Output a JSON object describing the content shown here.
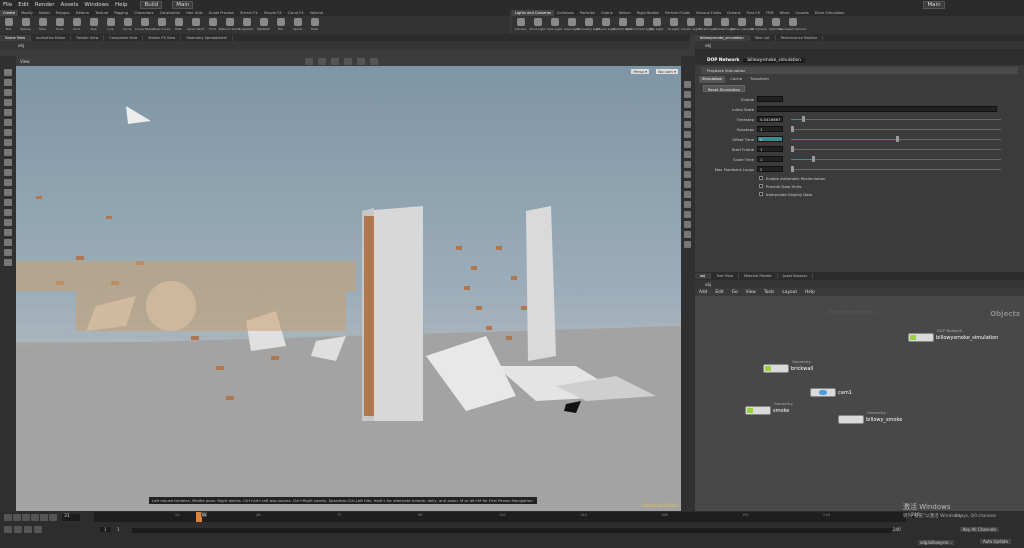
{
  "menu": {
    "items": [
      "File",
      "Edit",
      "Render",
      "Assets",
      "Windows",
      "Help"
    ],
    "desktop": "Build",
    "main": "Main",
    "right_label": "Main"
  },
  "shelf_left": {
    "tabs": [
      "Create",
      "Modify",
      "Model",
      "Polygon",
      "Deform",
      "Texture",
      "Rigging",
      "Characters",
      "Constraints",
      "Hair Utils",
      "Guide Process",
      "Terrain FX",
      "Simple FX",
      "Cloud FX",
      "Volume"
    ],
    "tools": [
      "Box",
      "Sphere",
      "Tube",
      "Torus",
      "Grid",
      "Null",
      "Line",
      "Circle",
      "Curve Bezier",
      "Draw Curve",
      "Path",
      "Spray Paint",
      "Font",
      "Platonic Solids",
      "L-System",
      "Metaball",
      "File",
      "Spiral",
      "Helix"
    ]
  },
  "shelf_right": {
    "tabs": [
      "Lights and Cameras",
      "Collisions",
      "Particles",
      "Grains",
      "Vellum",
      "Rigid Bodies",
      "Particle Fluids",
      "Viscous Fluids",
      "Oceans",
      "Pyro FX",
      "FEM",
      "Wires",
      "Crowds",
      "Drive Simulation"
    ],
    "tools": [
      "Camera",
      "Point Light",
      "Spot Light",
      "Area Light",
      "Geometry Light",
      "Volume Light",
      "Distant Light",
      "Environment Light",
      "Sky Light",
      "GI Light",
      "Caustic Light",
      "Portal Light",
      "Ambient Light",
      "Stereo Camera",
      "VR Camera",
      "Switcher",
      "Gamepad Camera"
    ]
  },
  "viewport_tabs": [
    "Scene View",
    "Animation Editor",
    "Render View",
    "Composite View",
    "Motion FX View",
    "Geometry Spreadsheet"
  ],
  "viewport": {
    "path": "obj",
    "view_label": "View",
    "persp": "Persp ▾",
    "cam": "No cam ▾",
    "hint": "Left mouse tumbles. Middle pans. Right dollies. Ctrl+Alt+Left box-zooms. Ctrl+Right zooms. Spacebar-Ctrl-Left tilts. Hold L for alternate tumble, dolly, and zoom.    M or Alt+M for First Person Navigation.",
    "edu": "Education Edition"
  },
  "parm_tabs": [
    "billowysmoke_simulation",
    "Take List",
    "Performance Monitor"
  ],
  "parm": {
    "path": "obj",
    "type": "DOP Network",
    "name": "billowysmoke_simulation",
    "header": "Playback Simulation",
    "tabs": [
      "Simulation",
      "Cache",
      "Transform"
    ],
    "reset": "Reset Simulation",
    "rows": [
      {
        "label": "Enable",
        "value": ""
      },
      {
        "label": "Initial State",
        "value": ""
      },
      {
        "label": "Timestep",
        "value": "0.0416667",
        "fill": 0.05
      },
      {
        "label": "Substeps",
        "value": "1",
        "fill": 0
      },
      {
        "label": "Offset Time",
        "value": "0",
        "fill": 0.5
      },
      {
        "label": "Start Frame",
        "value": "1",
        "fill": 0
      },
      {
        "label": "Scale Time",
        "value": "1",
        "fill": 0.1
      },
      {
        "label": "Max Feedback Loops",
        "value": "2",
        "fill": 0
      }
    ],
    "checks": [
      "Enable Automatic Resimulation",
      "Provide Data Hints",
      "Interpolate Display Data"
    ]
  },
  "net_tabs": [
    "obj",
    "Tree View",
    "Material Palette",
    "Asset Browser"
  ],
  "net": {
    "path": "obj",
    "menu": [
      "Add",
      "Edit",
      "Go",
      "View",
      "Tools",
      "Layout",
      "Help"
    ],
    "watermark": "Education Edition",
    "context": "Objects",
    "nodes": [
      {
        "type": "DOP Network",
        "name": "billowysmoke_simulation",
        "color": "#9ccf3c"
      },
      {
        "type": "Geometry",
        "name": "brickwall",
        "color": "#9ccf3c"
      },
      {
        "type": "",
        "name": "cam1",
        "color": "#4da0d8"
      },
      {
        "type": "Geometry",
        "name": "smoke",
        "color": "#9ccf3c"
      },
      {
        "type": "Geometry",
        "name": "billowy_smoke",
        "color": "#cccccc"
      }
    ]
  },
  "timeline": {
    "frame": "31",
    "start": "1",
    "start2": "1",
    "end": "240",
    "end2": "240",
    "ticks": [
      "24",
      "48",
      "72",
      "96",
      "120",
      "144",
      "168",
      "192",
      "216"
    ],
    "marker": "31",
    "progress": 0.125,
    "key_label": "Key All Channels",
    "auto": "Auto Update",
    "channels": "0 keys, 0/0 channels"
  },
  "watermark": {
    "line1": "激活 Windows",
    "line2": "转到\"设置\"以激活 Windows。"
  },
  "taskbar": {
    "app": "sdg.billowysm..."
  }
}
